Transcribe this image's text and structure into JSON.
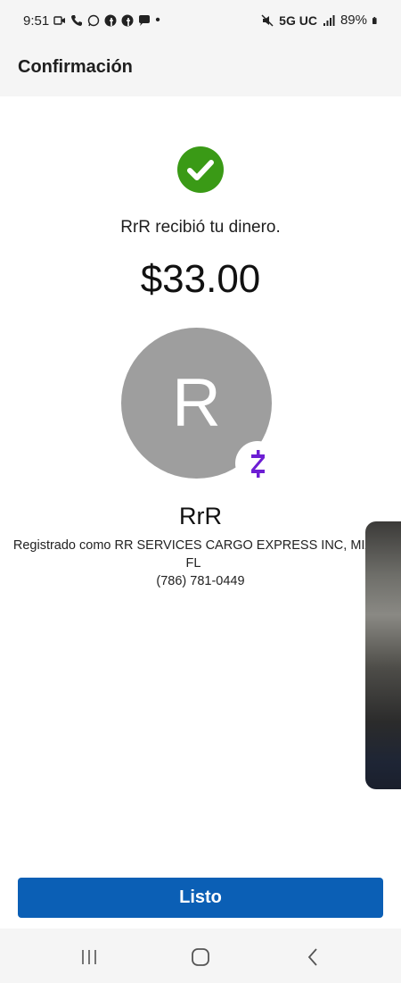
{
  "status_bar": {
    "time": "9:51",
    "network": "5G UC",
    "battery": "89%"
  },
  "header": {
    "title": "Confirmación"
  },
  "confirmation": {
    "message": "RrR recibió tu dinero.",
    "amount": "$33.00"
  },
  "recipient": {
    "initial": "R",
    "name": "RrR",
    "registered": "Registrado como RR SERVICES CARGO EXPRESS INC, MIA FL",
    "phone": "(786) 781-0449"
  },
  "actions": {
    "done_label": "Listo"
  },
  "colors": {
    "success": "#3a9a16",
    "primary": "#0b5fb5",
    "zelle": "#6d1ed4",
    "avatar": "#9e9e9e"
  },
  "icons": {
    "success": "checkmark-icon",
    "brand": "zelle-logo-icon",
    "nav": [
      "recent-apps-icon",
      "home-icon",
      "back-icon"
    ]
  }
}
